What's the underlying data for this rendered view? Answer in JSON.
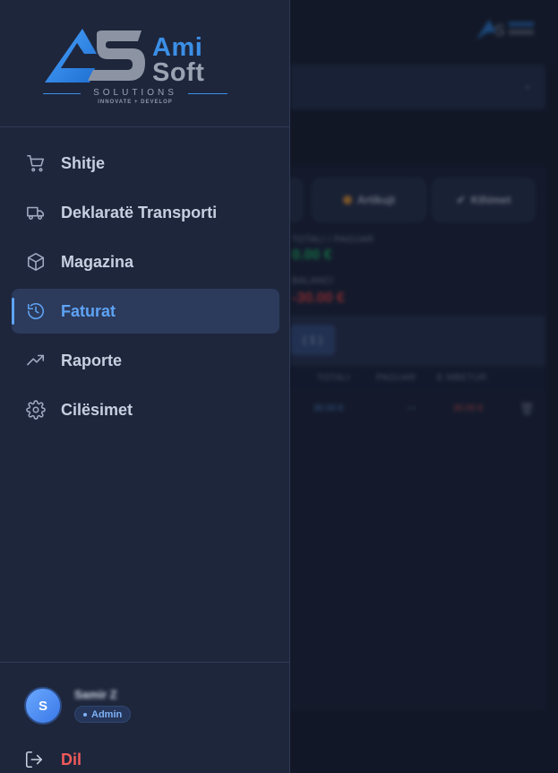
{
  "brand": {
    "ami": "Ami",
    "soft": "Soft",
    "sub": "SOLUTIONS",
    "tagline": "INNOVATE + DEVELOP",
    "color_blue": "#3b8fe6",
    "color_gray": "#9aa3b2"
  },
  "sidebar": {
    "items": [
      {
        "label": "Shitje",
        "icon": "cart-icon",
        "active": false
      },
      {
        "label": "Deklaratë Transporti",
        "icon": "truck-icon",
        "active": false
      },
      {
        "label": "Magazina",
        "icon": "box-icon",
        "active": false
      },
      {
        "label": "Faturat",
        "icon": "history-icon",
        "active": true
      },
      {
        "label": "Raporte",
        "icon": "trending-up-icon",
        "active": false
      },
      {
        "label": "Cilësimet",
        "icon": "gear-icon",
        "active": false
      }
    ],
    "active_color": "#5ea3f5"
  },
  "user": {
    "initial": "S",
    "name": "Samir Z",
    "role": "Admin"
  },
  "logout": {
    "label": "Dil",
    "color": "#f05a5a"
  },
  "background": {
    "chip_articles": "Artikujt",
    "chip_payments": "Kthimet",
    "label_total_paid": "TOTALI I PAGUAR",
    "value_total_paid": "0.00 €",
    "label_balance": "BALANCI",
    "value_balance": "-30.00 €",
    "tab_count": "( 1 )",
    "columns": [
      "TOTALI",
      "PAGUAR",
      "E MBETUR"
    ],
    "row": {
      "total": "30.00 €",
      "paid": "—",
      "remaining": "30.00 €"
    }
  }
}
